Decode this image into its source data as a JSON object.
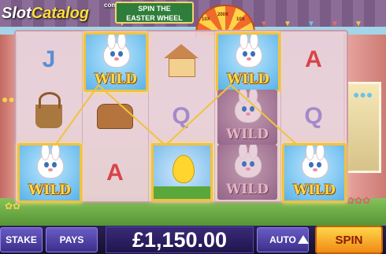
{
  "logo": {
    "prefix": "Slot",
    "suffix": "Catalog",
    "tld": "com"
  },
  "banner": {
    "line1": "SPIN THE",
    "line2": "EASTER WHEEL"
  },
  "wheel": {
    "labels": [
      "10X",
      "200X",
      "10X"
    ]
  },
  "reels": {
    "columns": 5,
    "rows": 3,
    "symbols": [
      [
        "J",
        "WILD",
        "house",
        "WILD",
        "A"
      ],
      [
        "basket",
        "bread",
        "Q",
        "WILD",
        "Q"
      ],
      [
        "WILD",
        "A",
        "egg",
        "WILD",
        "WILD"
      ]
    ],
    "wild_label": "WILD",
    "highlighted": [
      "wild-r0c1",
      "wild-r0c3",
      "wild-r2c0",
      "egg-r2c2",
      "wild-r2c4"
    ]
  },
  "controls": {
    "stake_label": "STAKE",
    "pays_label": "PAYS",
    "balance": "£1,150.00",
    "auto_label": "AUTO",
    "spin_label": "SPIN"
  },
  "colors": {
    "wild_gold": "#ffd84a",
    "spin_button": "#f5a623",
    "control_bar": "#2a1f55",
    "payline": "#f1c23f"
  }
}
